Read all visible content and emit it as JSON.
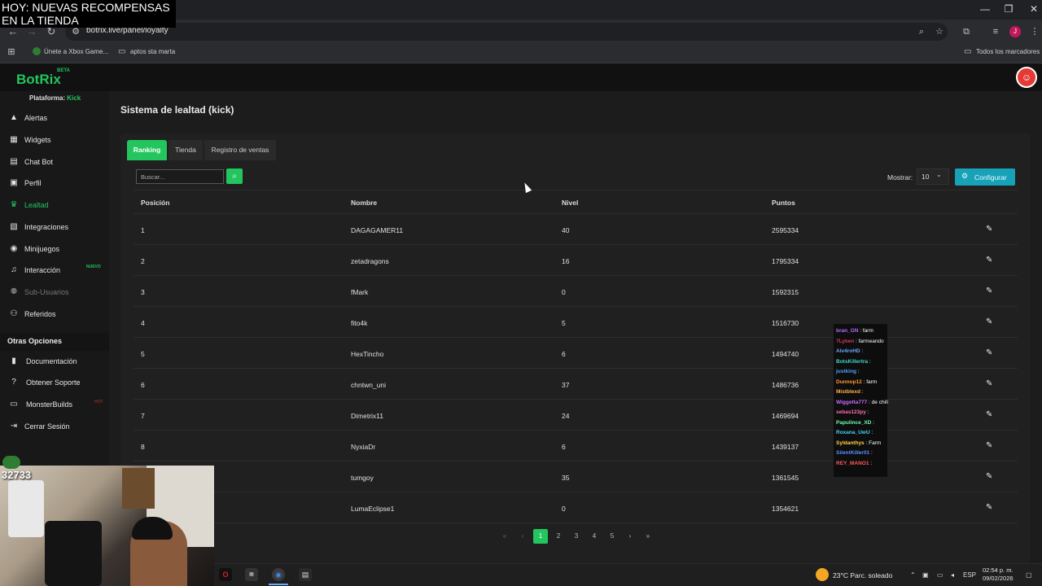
{
  "overlay": {
    "line1": "HOY: NUEVAS RECOMPENSAS",
    "line2": "EN LA TIENDA"
  },
  "browser": {
    "url": "botrix.live/panel/loyalty",
    "profile_initial": "J",
    "bookmarks": [
      {
        "label": "Únete a Xbox Game..."
      },
      {
        "label": "aptos sta marta"
      }
    ],
    "all_bookmarks": "Todos los marcadores"
  },
  "app": {
    "logo": "BotRix",
    "beta": "BETA",
    "platform_label": "Plataforma:",
    "platform_value": "Kick"
  },
  "sidebar": {
    "items": [
      {
        "label": "Alertas",
        "icon": "warning-icon",
        "state": "normal"
      },
      {
        "label": "Widgets",
        "icon": "grid-icon",
        "state": "normal"
      },
      {
        "label": "Chat Bot",
        "icon": "chat-icon",
        "state": "normal"
      },
      {
        "label": "Perfil",
        "icon": "id-card-icon",
        "state": "normal"
      },
      {
        "label": "Lealtad",
        "icon": "trophy-icon",
        "state": "active"
      },
      {
        "label": "Integraciones",
        "icon": "plug-icon",
        "state": "normal"
      },
      {
        "label": "Minijuegos",
        "icon": "gamepad-icon",
        "state": "normal"
      },
      {
        "label": "Interacción",
        "icon": "music-icon",
        "state": "normal",
        "badge": "NUEVO"
      },
      {
        "label": "Sub-Usuarios",
        "icon": "users-icon",
        "state": "disabled"
      },
      {
        "label": "Referidos",
        "icon": "people-icon",
        "state": "normal"
      }
    ],
    "other_header": "Otras Opciones",
    "other_items": [
      {
        "label": "Documentación",
        "icon": "book-icon"
      },
      {
        "label": "Obtener Soporte",
        "icon": "help-icon"
      },
      {
        "label": "MonsterBuilds",
        "icon": "monitor-icon",
        "badge": "HOT"
      },
      {
        "label": "Cerrar Sesión",
        "icon": "logout-icon"
      }
    ]
  },
  "page": {
    "title": "Sistema de lealtad (kick)",
    "tabs": [
      {
        "label": "Ranking",
        "active": true
      },
      {
        "label": "Tienda",
        "active": false
      },
      {
        "label": "Registro de ventas",
        "active": false
      }
    ],
    "search_placeholder": "Buscar...",
    "show_label": "Mostrar:",
    "show_value": "10",
    "config_label": "Configurar"
  },
  "table": {
    "columns": [
      "Posición",
      "Nombre",
      "Nivel",
      "Puntos"
    ],
    "rows": [
      {
        "pos": "1",
        "name": "DAGAGAMER11",
        "level": "40",
        "points": "2595334"
      },
      {
        "pos": "2",
        "name": "zetadragons",
        "level": "16",
        "points": "1795334"
      },
      {
        "pos": "3",
        "name": "fMark",
        "level": "0",
        "points": "1592315"
      },
      {
        "pos": "4",
        "name": "fito4k",
        "level": "5",
        "points": "1516730"
      },
      {
        "pos": "5",
        "name": "HexTincho",
        "level": "6",
        "points": "1494740"
      },
      {
        "pos": "6",
        "name": "chntwn_uni",
        "level": "37",
        "points": "1486736"
      },
      {
        "pos": "7",
        "name": "Dimetrix11",
        "level": "24",
        "points": "1469694"
      },
      {
        "pos": "8",
        "name": "NyxiaDr",
        "level": "6",
        "points": "1439137"
      },
      {
        "pos": "",
        "name": "tumgoy",
        "level": "35",
        "points": "1361545"
      },
      {
        "pos": "",
        "name": "LumaEclipse1",
        "level": "0",
        "points": "1354621"
      }
    ]
  },
  "pagination": {
    "pages": [
      "1",
      "2",
      "3",
      "4",
      "5"
    ],
    "current": "1"
  },
  "chat": [
    {
      "user": "bran_GN",
      "msg": ": farm",
      "color": "#b06cff"
    },
    {
      "user": "7Lyken",
      "msg": ": farmeando",
      "color": "#d13a5b"
    },
    {
      "user": "Alv4roHD",
      "msg": ":",
      "color": "#6aa7ff"
    },
    {
      "user": "BotsKillertra",
      "msg": ":",
      "color": "#44d6c8"
    },
    {
      "user": "justking",
      "msg": ":",
      "color": "#4aa3ff"
    },
    {
      "user": "Dunnop12",
      "msg": ": farm",
      "color": "#ff9b3a"
    },
    {
      "user": "Mistblexd",
      "msg": ":",
      "color": "#ffb14a"
    },
    {
      "user": "Wiggetta777",
      "msg": ": de chill",
      "color": "#c56cff"
    },
    {
      "user": "sebas123py",
      "msg": ":",
      "color": "#ff6db3"
    },
    {
      "user": "Papulince_XD",
      "msg": ":",
      "color": "#6cffb0"
    },
    {
      "user": "Roxana_UwU",
      "msg": ":",
      "color": "#4ad0ff"
    },
    {
      "user": "Syldanthys",
      "msg": ": Farm",
      "color": "#ffd24a"
    },
    {
      "user": "SilentKiller01",
      "msg": ":",
      "color": "#5a8dff"
    },
    {
      "user": "REY_MANO1",
      "msg": ":",
      "color": "#ff5a5a"
    }
  ],
  "webcam": {
    "counter": "32733"
  },
  "taskbar": {
    "weather": "23°C  Parc. soleado",
    "lang": "ESP",
    "time": "02:54 p. m.",
    "date": "09/02/2026"
  },
  "colors": {
    "accent": "#22c55e",
    "config": "#17a2b8"
  }
}
